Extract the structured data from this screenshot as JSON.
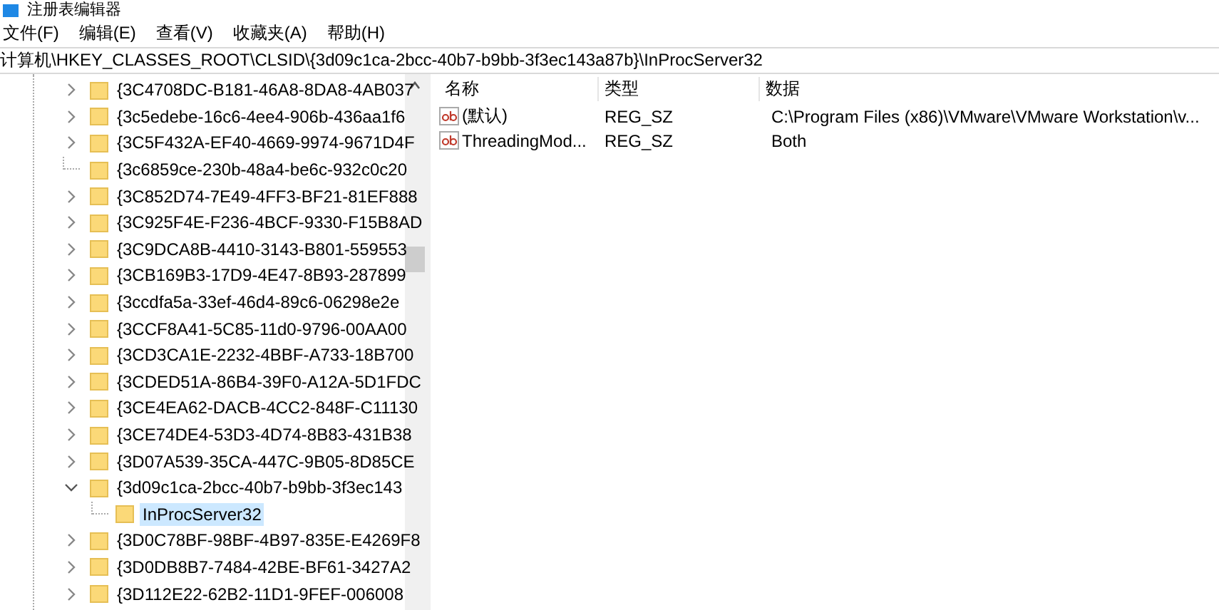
{
  "window": {
    "title": "注册表编辑器"
  },
  "menu": [
    "文件(F)",
    "编辑(E)",
    "查看(V)",
    "收藏夹(A)",
    "帮助(H)"
  ],
  "address": "计算机\\HKEY_CLASSES_ROOT\\CLSID\\{3d09c1ca-2bcc-40b7-b9bb-3f3ec143a87b}\\InProcServer32",
  "tree": [
    {
      "label": "{3C4708DC-B181-46A8-8DA8-4AB037",
      "has_children": true,
      "expanded": false,
      "selected": false
    },
    {
      "label": "{3c5edebe-16c6-4ee4-906b-436aa1f6",
      "has_children": true,
      "expanded": false,
      "selected": false
    },
    {
      "label": "{3C5F432A-EF40-4669-9974-9671D4F",
      "has_children": true,
      "expanded": false,
      "selected": false
    },
    {
      "label": "{3c6859ce-230b-48a4-be6c-932c0c20",
      "has_children": false,
      "selected": false
    },
    {
      "label": "{3C852D74-7E49-4FF3-BF21-81EF888",
      "has_children": true,
      "expanded": false,
      "selected": false
    },
    {
      "label": "{3C925F4E-F236-4BCF-9330-F15B8AD",
      "has_children": true,
      "expanded": false,
      "selected": false
    },
    {
      "label": "{3C9DCA8B-4410-3143-B801-559553",
      "has_children": true,
      "expanded": false,
      "selected": false
    },
    {
      "label": "{3CB169B3-17D9-4E47-8B93-287899",
      "has_children": true,
      "expanded": false,
      "selected": false
    },
    {
      "label": "{3ccdfa5a-33ef-46d4-89c6-06298e2e",
      "has_children": true,
      "expanded": false,
      "selected": false
    },
    {
      "label": "{3CCF8A41-5C85-11d0-9796-00AA00",
      "has_children": true,
      "expanded": false,
      "selected": false
    },
    {
      "label": "{3CD3CA1E-2232-4BBF-A733-18B700",
      "has_children": true,
      "expanded": false,
      "selected": false
    },
    {
      "label": "{3CDED51A-86B4-39F0-A12A-5D1FDC",
      "has_children": true,
      "expanded": false,
      "selected": false
    },
    {
      "label": "{3CE4EA62-DACB-4CC2-848F-C11130",
      "has_children": true,
      "expanded": false,
      "selected": false
    },
    {
      "label": "{3CE74DE4-53D3-4D74-8B83-431B38",
      "has_children": true,
      "expanded": false,
      "selected": false
    },
    {
      "label": "{3D07A539-35CA-447C-9B05-8D85CE",
      "has_children": true,
      "expanded": false,
      "selected": false
    },
    {
      "label": "{3d09c1ca-2bcc-40b7-b9bb-3f3ec143",
      "has_children": true,
      "expanded": true,
      "selected": false,
      "children": [
        {
          "label": "InProcServer32",
          "has_children": false,
          "selected": true
        }
      ]
    },
    {
      "label": "{3D0C78BF-98BF-4B97-835E-E4269F8",
      "has_children": true,
      "expanded": false,
      "selected": false
    },
    {
      "label": "{3D0DB8B7-7484-42BE-BF61-3427A2",
      "has_children": true,
      "expanded": false,
      "selected": false
    },
    {
      "label": "{3D112E22-62B2-11D1-9FEF-006008",
      "has_children": true,
      "expanded": false,
      "selected": false
    }
  ],
  "table": {
    "columns": [
      "名称",
      "类型",
      "数据"
    ],
    "rows": [
      {
        "name": "(默认)",
        "type": "REG_SZ",
        "data": "C:\\Program Files (x86)\\VMware\\VMware Workstation\\v..."
      },
      {
        "name": "ThreadingMod...",
        "type": "REG_SZ",
        "data": "Both"
      }
    ]
  }
}
